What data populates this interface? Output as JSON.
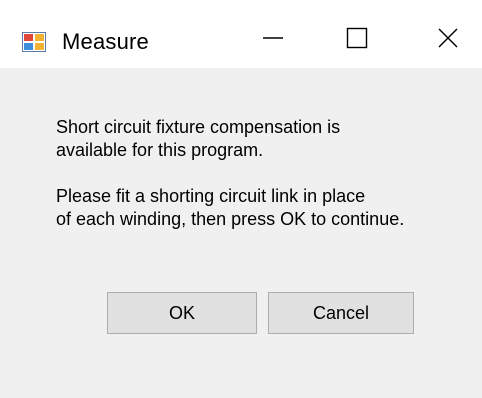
{
  "window": {
    "title": "Measure",
    "app_icon": "measure-app-icon",
    "controls": {
      "minimize_icon": "minimize-icon",
      "maximize_icon": "maximize-icon",
      "close_icon": "close-icon"
    }
  },
  "message": {
    "paragraph_1": "Short circuit fixture compensation is\navailable for this program.",
    "paragraph_2": "Please fit a shorting circuit link in place\nof each winding, then press OK to continue."
  },
  "buttons": {
    "ok_label": "OK",
    "cancel_label": "Cancel"
  },
  "colors": {
    "background": "#f0f0f0",
    "titlebar": "#ffffff",
    "button_face": "#e1e1e1",
    "button_border": "#adadad"
  }
}
